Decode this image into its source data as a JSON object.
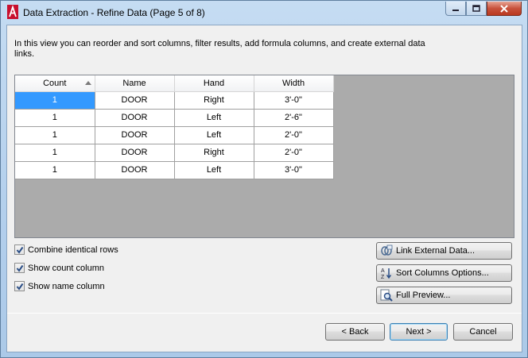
{
  "window": {
    "title": "Data Extraction - Refine Data (Page 5 of 8)"
  },
  "instructions": "In this view you can reorder and sort columns, filter results, add formula columns, and create external data links.",
  "grid": {
    "columns": [
      "Count",
      "Name",
      "Hand",
      "Width"
    ],
    "rows": [
      [
        "1",
        "DOOR",
        "Right",
        "3'-0\""
      ],
      [
        "1",
        "DOOR",
        "Left",
        "2'-6\""
      ],
      [
        "1",
        "DOOR",
        "Left",
        "2'-0\""
      ],
      [
        "1",
        "DOOR",
        "Right",
        "2'-0\""
      ],
      [
        "1",
        "DOOR",
        "Left",
        "3'-0\""
      ]
    ]
  },
  "options": {
    "combine_identical_rows": "Combine identical rows",
    "show_count_column": "Show count column",
    "show_name_column": "Show name column"
  },
  "side_buttons": {
    "link_external_data": "Link External Data...",
    "sort_columns_options": "Sort Columns Options...",
    "full_preview": "Full Preview..."
  },
  "nav_buttons": {
    "back": "< Back",
    "next": "Next >",
    "cancel": "Cancel"
  },
  "colors": {
    "selection": "#3399ff",
    "grid_background": "#ababab",
    "app_icon_red": "#c8102e"
  },
  "icons": {
    "app": "autocad-logo-icon",
    "link": "link-external-data-icon",
    "sort": "sort-az-icon",
    "preview": "magnifier-preview-icon"
  }
}
